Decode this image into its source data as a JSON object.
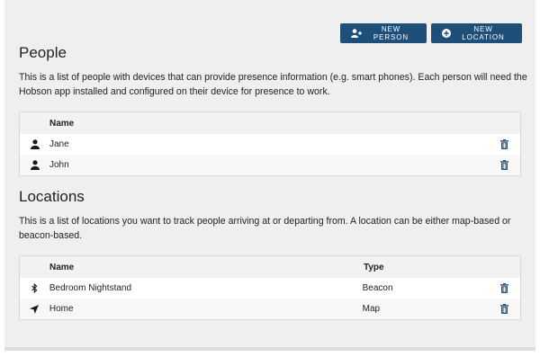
{
  "toolbar": {
    "new_person_label": "NEW PERSON",
    "new_location_label": "NEW LOCATION"
  },
  "people": {
    "title": "People",
    "description": "This is a list of people with devices that can provide presence information (e.g. smart phones). Each person will need the Hobson app installed and configured on their device for presence to work.",
    "columns": {
      "name": "Name"
    },
    "rows": [
      {
        "name": "Jane",
        "icon": "user-icon"
      },
      {
        "name": "John",
        "icon": "user-icon"
      }
    ]
  },
  "locations": {
    "title": "Locations",
    "description": "This is a list of locations you want to track people arriving at or departing from. A location can be either map-based or beacon-based.",
    "columns": {
      "name": "Name",
      "type": "Type"
    },
    "rows": [
      {
        "name": "Bedroom Nightstand",
        "type": "Beacon",
        "icon": "bluetooth-icon"
      },
      {
        "name": "Home",
        "type": "Map",
        "icon": "location-arrow-icon"
      }
    ]
  },
  "colors": {
    "button_bg": "#1d4f79",
    "delete_icon": "#1d4f79",
    "panel_bg": "#efefef"
  }
}
